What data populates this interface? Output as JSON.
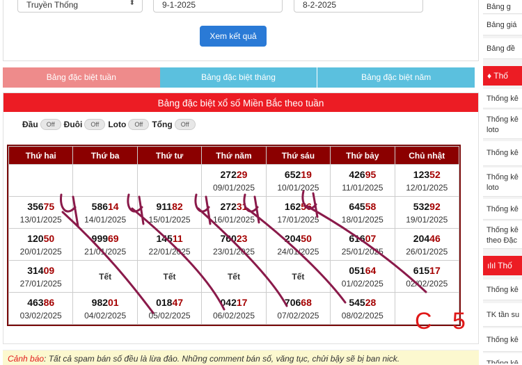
{
  "form": {
    "type_select": "Truyền Thống",
    "date_from": "9-1-2025",
    "date_to": "8-2-2025",
    "submit_label": "Xem kết quả"
  },
  "tabs": [
    "Bảng đặc biệt tuần",
    "Bảng đặc biệt tháng",
    "Bảng đặc biệt năm"
  ],
  "banner": "Bảng đặc biệt xổ số Miền Bắc theo tuần",
  "toggles": [
    {
      "label": "Đầu",
      "state": "Off"
    },
    {
      "label": "Đuôi",
      "state": "Off"
    },
    {
      "label": "Loto",
      "state": "Off"
    },
    {
      "label": "Tổng",
      "state": "Off"
    }
  ],
  "table": {
    "headers": [
      "Thứ hai",
      "Thứ ba",
      "Thứ tư",
      "Thứ năm",
      "Thứ sáu",
      "Thứ bảy",
      "Chủ nhật"
    ],
    "rows": [
      [
        {
          "prefix": "",
          "suffix": "",
          "date": "",
          "bg": "white"
        },
        {
          "prefix": "",
          "suffix": "",
          "date": "",
          "bg": "white"
        },
        {
          "prefix": "",
          "suffix": "",
          "date": "",
          "bg": "white"
        },
        {
          "prefix": "272",
          "suffix": "29",
          "date": "09/01/2025",
          "bg": "white"
        },
        {
          "prefix": "652",
          "suffix": "19",
          "date": "10/01/2025",
          "bg": "white"
        },
        {
          "prefix": "426",
          "suffix": "95",
          "date": "11/01/2025",
          "bg": "green"
        },
        {
          "prefix": "123",
          "suffix": "52",
          "date": "12/01/2025",
          "bg": "green"
        }
      ],
      [
        {
          "prefix": "356",
          "suffix": "75",
          "date": "13/01/2025",
          "bg": "gold"
        },
        {
          "prefix": "586",
          "suffix": "14",
          "date": "14/01/2025",
          "bg": "gold"
        },
        {
          "prefix": "911",
          "suffix": "82",
          "date": "15/01/2025",
          "bg": "gold"
        },
        {
          "prefix": "272",
          "suffix": "31",
          "date": "16/01/2025",
          "bg": "gold"
        },
        {
          "prefix": "162",
          "suffix": "56",
          "date": "17/01/2025",
          "bg": "gold"
        },
        {
          "prefix": "645",
          "suffix": "58",
          "date": "18/01/2025",
          "bg": "green"
        },
        {
          "prefix": "532",
          "suffix": "92",
          "date": "19/01/2025",
          "bg": "green"
        }
      ],
      [
        {
          "prefix": "120",
          "suffix": "50",
          "date": "20/01/2025",
          "bg": "white"
        },
        {
          "prefix": "999",
          "suffix": "69",
          "date": "21/01/2025",
          "bg": "white"
        },
        {
          "prefix": "145",
          "suffix": "11",
          "date": "22/01/2025",
          "bg": "white"
        },
        {
          "prefix": "760",
          "suffix": "23",
          "date": "23/01/2025",
          "bg": "white"
        },
        {
          "prefix": "204",
          "suffix": "50",
          "date": "24/01/2025",
          "bg": "white"
        },
        {
          "prefix": "616",
          "suffix": "07",
          "date": "25/01/2025",
          "bg": "green"
        },
        {
          "prefix": "204",
          "suffix": "46",
          "date": "26/01/2025",
          "bg": "green"
        }
      ],
      [
        {
          "prefix": "314",
          "suffix": "09",
          "date": "27/01/2025",
          "bg": "white"
        },
        {
          "tet": "Tết",
          "bg": "white"
        },
        {
          "tet": "Tết",
          "bg": "white"
        },
        {
          "tet": "Tết",
          "bg": "white"
        },
        {
          "tet": "Tết",
          "bg": "white"
        },
        {
          "prefix": "051",
          "suffix": "64",
          "date": "01/02/2025",
          "bg": "green"
        },
        {
          "prefix": "615",
          "suffix": "17",
          "date": "02/02/2025",
          "bg": "green"
        }
      ],
      [
        {
          "prefix": "463",
          "suffix": "86",
          "date": "03/02/2025",
          "bg": "white"
        },
        {
          "prefix": "982",
          "suffix": "01",
          "date": "04/02/2025",
          "bg": "white"
        },
        {
          "prefix": "018",
          "suffix": "47",
          "date": "05/02/2025",
          "bg": "gold"
        },
        {
          "prefix": "042",
          "suffix": "17",
          "date": "06/02/2025",
          "bg": "gold"
        },
        {
          "prefix": "706",
          "suffix": "68",
          "date": "07/02/2025",
          "bg": "gold"
        },
        {
          "prefix": "545",
          "suffix": "28",
          "date": "08/02/2025",
          "bg": "gold"
        },
        {
          "prefix": "",
          "suffix": "",
          "date": "",
          "bg": "gold"
        }
      ]
    ]
  },
  "annotation": "C 5",
  "warning": {
    "label": "Cảnh báo",
    "text": ": Tất cả spam bán số đều là lừa đảo. Những comment bán số, văng tục, chửi bậy sẽ bị ban nick."
  },
  "sidebar": {
    "items_top": [
      "Bảng g",
      "Bảng giá",
      "Bảng đề"
    ],
    "head1": "♦ Thố",
    "items_mid": [
      "Thống kê",
      "Thống kê loto",
      "Thống kê",
      "Thống kê loto",
      "Thống kê",
      "Thống kê theo Đặc"
    ],
    "head2": "ılıl Thố",
    "items_bot": [
      "Thống kê",
      "TK tần su",
      "Thống kê",
      "Thống kê"
    ]
  },
  "colors": {
    "banner_red": "#ec1c24",
    "header_dark_red": "#8b0000",
    "tab_active": "#ee8b8b",
    "tab_inactive": "#5bc0de",
    "highlight_gold": "#ffc000",
    "weekend_green": "#e6f4e0",
    "scribble": "#8a1a4a"
  }
}
